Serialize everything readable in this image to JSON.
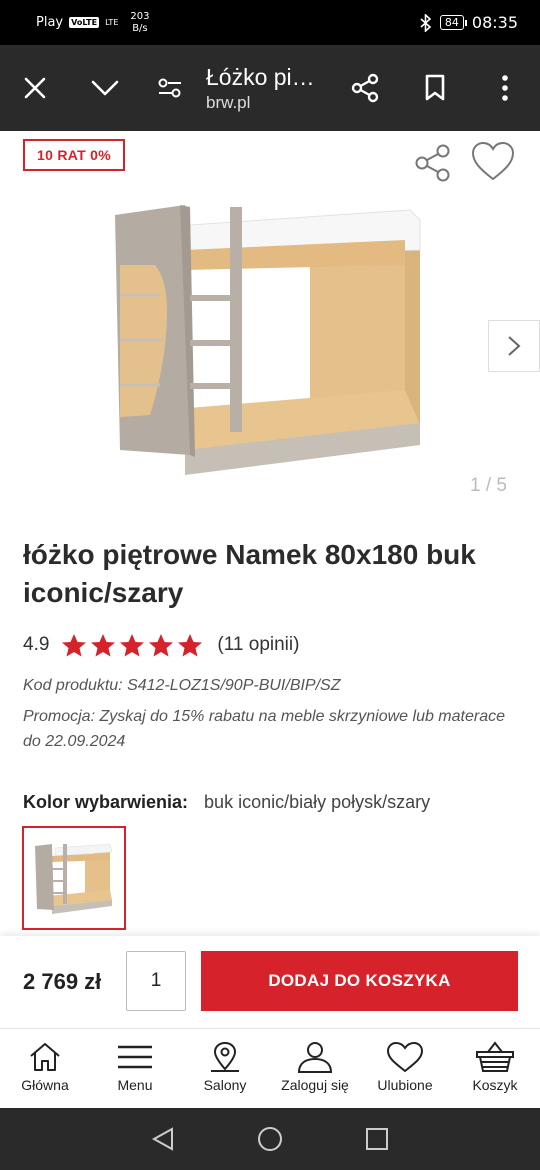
{
  "status_bar": {
    "carrier": "Play",
    "volte": "VoLTE",
    "network": "LTE",
    "speed_value": "203",
    "speed_unit": "B/s",
    "battery": "84",
    "time": "08:35"
  },
  "app_bar": {
    "title": "Łóżko pi…",
    "subtitle": "brw.pl"
  },
  "product": {
    "badge": "10 RAT 0%",
    "image_counter": "1 / 5",
    "title": "łóżko piętrowe Namek 80x180 buk iconic/szary",
    "rating": "4.9",
    "stars": 5,
    "reviews": "(11 opinii)",
    "code": "Kod produktu: S412-LOZ1S/90P-BUI/BIP/SZ",
    "promo": "Promocja: Zyskaj do 15% rabatu na meble skrzyniowe lub materace do 22.09.2024",
    "color_label": "Kolor wybarwienia:",
    "color_value": "buk iconic/biały połysk/szary"
  },
  "purchase": {
    "price": "2 769 zł",
    "quantity": "1",
    "add_to_cart": "DODAJ DO KOSZYKA"
  },
  "bottom_nav": [
    {
      "label": "Główna",
      "icon": "home-icon"
    },
    {
      "label": "Menu",
      "icon": "menu-icon"
    },
    {
      "label": "Salony",
      "icon": "map-pin-icon"
    },
    {
      "label": "Zaloguj się",
      "icon": "user-icon"
    },
    {
      "label": "Ulubione",
      "icon": "heart-icon"
    },
    {
      "label": "Koszyk",
      "icon": "basket-icon"
    }
  ],
  "colors": {
    "accent": "#d6222a",
    "appbar": "#2a2a2a",
    "wood": "#e9c68f",
    "grey_panel": "#b4aca2"
  }
}
